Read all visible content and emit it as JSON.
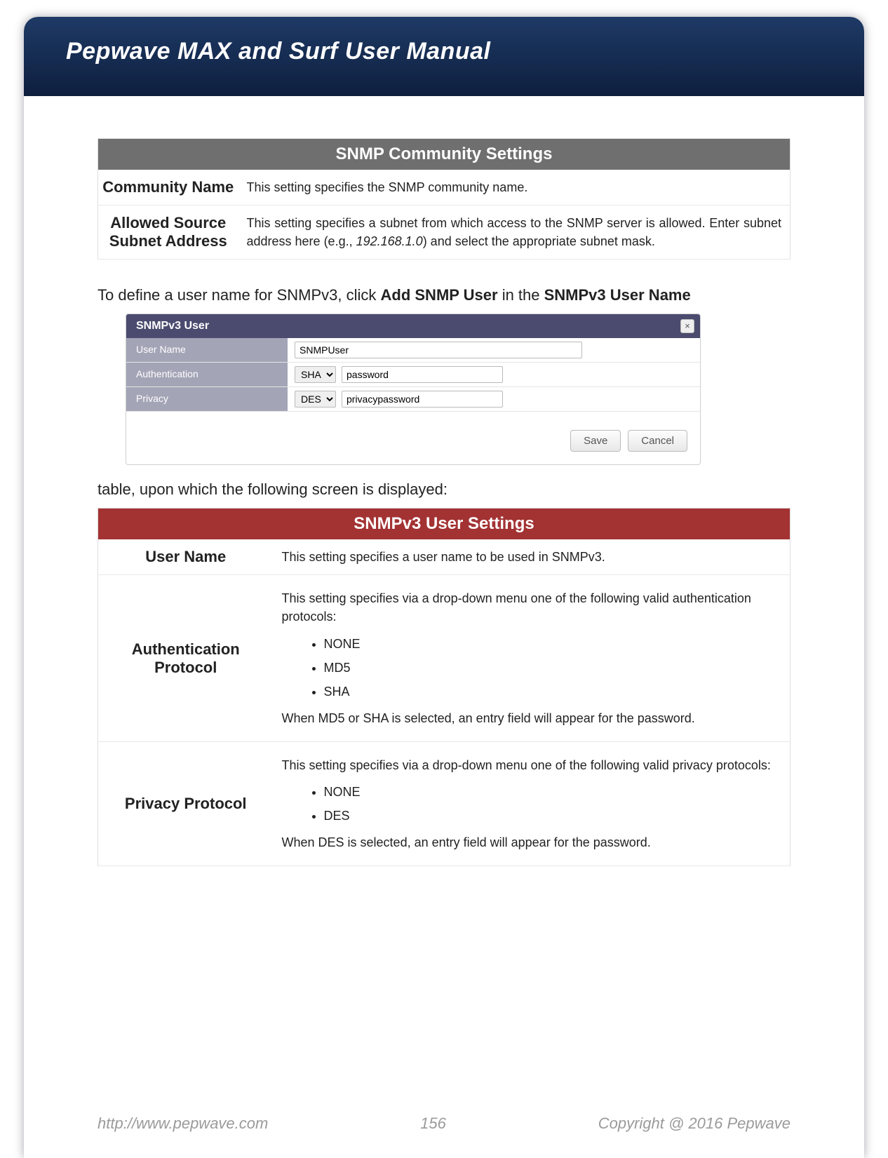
{
  "header": {
    "title": "Pepwave MAX and Surf User Manual"
  },
  "table1": {
    "title": "SNMP Community Settings",
    "rows": [
      {
        "label": "Community Name",
        "desc": "This setting specifies the SNMP community name."
      },
      {
        "label": "Allowed Source Subnet Address",
        "desc_pre": "This setting specifies a subnet from which access to the SNMP server is allowed. Enter subnet address here (e.g., ",
        "desc_italic": "192.168.1.0",
        "desc_post": ") and select the appropriate subnet mask."
      }
    ]
  },
  "para1": {
    "pre": "To define a user name for SNMPv3, click ",
    "b1": "Add SNMP User",
    "mid": " in the ",
    "b2": "SNMPv3 User Name"
  },
  "dialog": {
    "title": "SNMPv3 User",
    "close_glyph": "×",
    "rows": {
      "username": {
        "label": "User Name",
        "value": "SNMPUser"
      },
      "auth": {
        "label": "Authentication",
        "select": "SHA",
        "value": "password"
      },
      "privacy": {
        "label": "Privacy",
        "select": "DES",
        "value": "privacypassword"
      }
    },
    "buttons": {
      "save": "Save",
      "cancel": "Cancel"
    }
  },
  "para2": "table, upon which the following screen is displayed:",
  "table2": {
    "title": "SNMPv3 User Settings",
    "rows": {
      "username": {
        "label": "User Name",
        "desc": "This setting specifies a user name to be used in SNMPv3."
      },
      "auth": {
        "label": "Authentication Protocol",
        "intro": "This setting specifies via a drop-down menu one of the following valid authentication protocols:",
        "items": [
          "NONE",
          "MD5",
          "SHA"
        ],
        "note": "When MD5 or SHA is selected, an entry field will appear for the password."
      },
      "privacy": {
        "label": "Privacy Protocol",
        "intro": "This setting specifies via a drop-down menu one of the following valid privacy protocols:",
        "items": [
          "NONE",
          "DES"
        ],
        "note": "When DES is selected, an entry field will appear for the password."
      }
    }
  },
  "footer": {
    "url": "http://www.pepwave.com",
    "page": "156",
    "copyright": "Copyright @ 2016 Pepwave"
  }
}
